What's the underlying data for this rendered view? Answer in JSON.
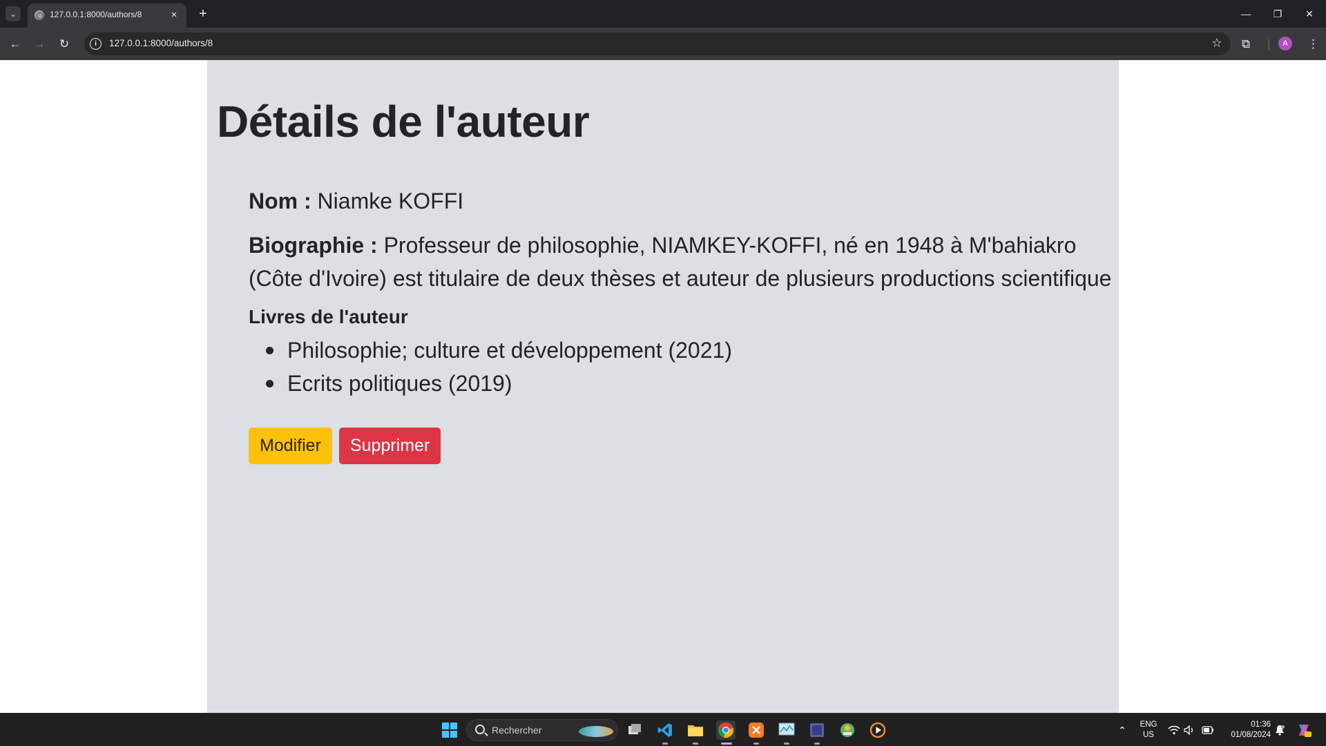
{
  "browser": {
    "tab_title": "127.0.0.1:8000/authors/8",
    "url": "127.0.0.1:8000/authors/8",
    "profile_initial": "A"
  },
  "page": {
    "title": "Détails de l'auteur",
    "name_label": "Nom :",
    "name_value": "Niamke KOFFI",
    "bio_label": "Biographie :",
    "bio_line1": "Professeur de philosophie, NIAMKEY-KOFFI, né en 1948 à M'bahiakro",
    "bio_line2": "(Côte d'Ivoire) est titulaire de deux thèses et auteur de plusieurs productions scientifique",
    "books_heading": "Livres de l'auteur",
    "books": [
      "Philosophie; culture et développement (2021)",
      "Ecrits politiques (2019)"
    ],
    "edit_button": "Modifier",
    "delete_button": "Supprimer"
  },
  "taskbar": {
    "search_placeholder": "Rechercher",
    "language": "ENG",
    "region": "US",
    "time": "01:36",
    "date": "01/08/2024"
  },
  "colors": {
    "container_bg": "#dcdfe4",
    "edit_button_bg": "#ffc107",
    "delete_button_bg": "#dc3545"
  }
}
